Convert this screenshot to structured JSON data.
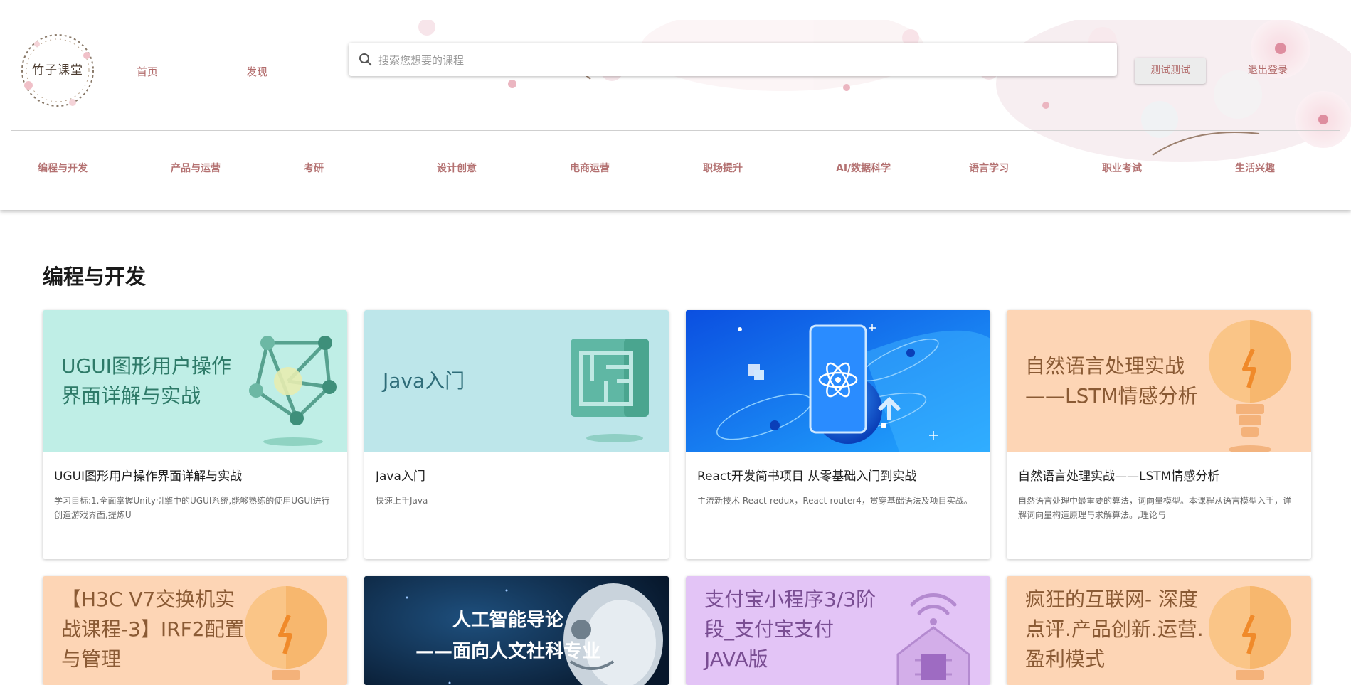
{
  "header": {
    "logo_text": "竹子课堂",
    "nav": {
      "home": "首页",
      "discover": "发现"
    },
    "search": {
      "placeholder": "搜索您想要的课程",
      "value": ""
    },
    "user_button": "测试测试",
    "logout": "退出登录",
    "categories": [
      "编程与开发",
      "产品与运营",
      "考研",
      "设计创意",
      "电商运营",
      "职场提升",
      "AI/数据科学",
      "语言学习",
      "职业考试",
      "生活兴趣"
    ]
  },
  "main": {
    "section_title": "编程与开发",
    "cards": [
      {
        "banner": "UGUI图形用户操作\n界面详解与实战",
        "title": "UGUI图形用户操作界面详解与实战",
        "desc": "学习目标:1.全面掌握Unity引擎中的UGUI系统,能够熟练的使用UGUI进行创造游戏界面,提炼U",
        "bg": "#bfeee6",
        "fg": "#2e7a68",
        "icon": "network-icon"
      },
      {
        "banner": "Java入门",
        "title": "Java入门",
        "desc": "快速上手Java",
        "bg": "#bde6ea",
        "fg": "#2f6d79",
        "icon": "map-scroll-icon"
      },
      {
        "banner": "",
        "title": "React开发简书项目 从零基础入门到实战",
        "desc": "主流新技术 React-redux，React-router4，贯穿基础语法及项目实战。",
        "bg": "#1a6ef0",
        "fg": "#ffffff",
        "icon": "react-phone-icon"
      },
      {
        "banner": "自然语言处理实战\n——LSTM情感分析",
        "title": "自然语言处理实战——LSTM情感分析",
        "desc": "自然语言处理中最重要的算法，词向量模型。本课程从语言模型入手，详解词向量构造原理与求解算法。,理论与",
        "bg": "#fdd5b5",
        "fg": "#8a5a34",
        "icon": "lightbulb-icon"
      },
      {
        "banner": "【H3C V7交换机实\n战课程-3】IRF2配置\n与管理",
        "title": "",
        "desc": "",
        "bg": "#fdd5b5",
        "fg": "#8a5a34",
        "icon": "lightbulb-icon"
      },
      {
        "banner": "人工智能导论\n——面向人文社科专业",
        "title": "",
        "desc": "",
        "bg": "#0d2540",
        "fg": "#ffffff",
        "icon": "robot-icon"
      },
      {
        "banner": "支付宝小程序3/3阶\n段_支付宝支付\nJAVA版",
        "title": "",
        "desc": "",
        "bg": "#e3c4f6",
        "fg": "#7a4e93",
        "icon": "chip-wifi-icon"
      },
      {
        "banner": "疯狂的互联网- 深度\n点评.产品创新.运营.\n盈利模式",
        "title": "",
        "desc": "",
        "bg": "#fdd5b5",
        "fg": "#8a5a34",
        "icon": "lightbulb-icon"
      }
    ]
  }
}
